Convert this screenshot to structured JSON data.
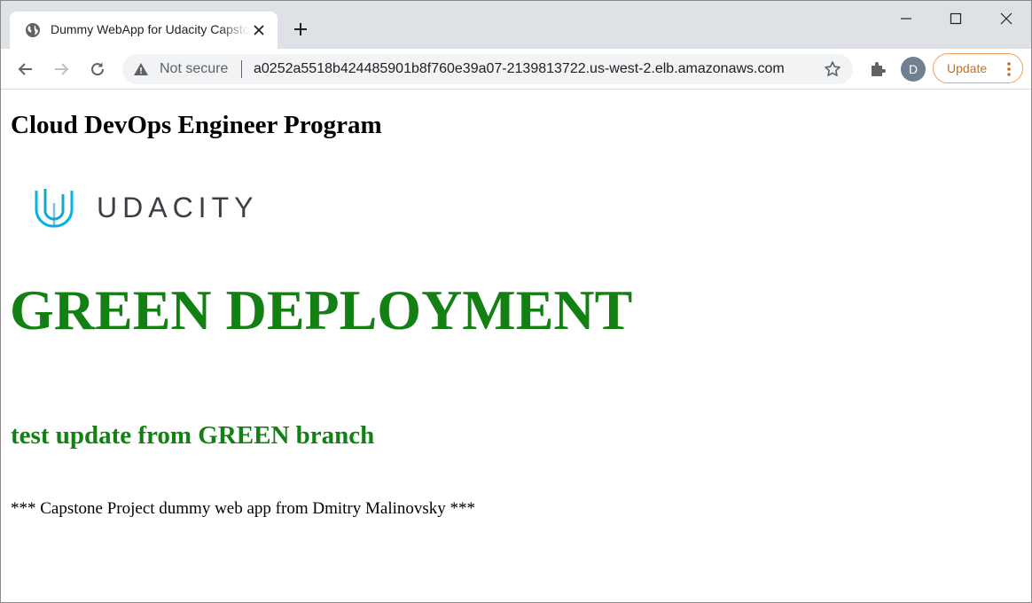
{
  "browser": {
    "tab": {
      "title": "Dummy WebApp for Udacity Capstone"
    },
    "toolbar": {
      "security_label": "Not secure",
      "url": "a0252a5518b424485901b8f760e39a07-2139813722.us-west-2.elb.amazonaws.com",
      "profile_initial": "D",
      "update_label": "Update"
    }
  },
  "page": {
    "heading": "Cloud DevOps Engineer Program",
    "logo_text": "UDACITY",
    "deployment_title": "GREEN DEPLOYMENT",
    "update_note": "test update from GREEN branch",
    "footer": "*** Capstone Project dummy web app from Dmitry Malinovsky ***"
  },
  "colors": {
    "deployment_green": "#138013",
    "update_accent": "#c5711b",
    "logo_teal": "#02b3e4",
    "logo_text": "#3a3f45"
  },
  "icons": [
    "globe-icon",
    "close-icon",
    "plus-icon",
    "minimize-icon",
    "maximize-icon",
    "window-close-icon",
    "back-arrow-icon",
    "forward-arrow-icon",
    "reload-icon",
    "warning-icon",
    "star-icon",
    "puzzle-icon",
    "more-vert-icon",
    "udacity-logo-icon"
  ]
}
